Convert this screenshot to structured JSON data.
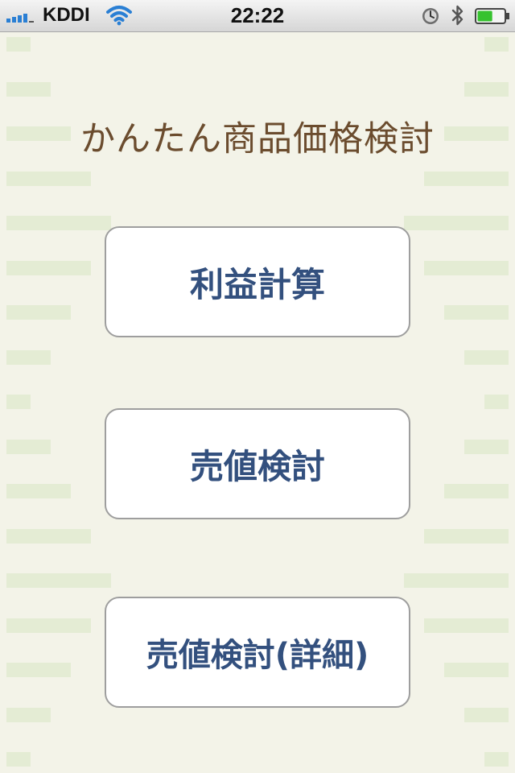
{
  "status_bar": {
    "carrier": "KDDI",
    "time": "22:22",
    "battery_level": 0.55,
    "battery_color": "#36c22f",
    "signal_color": "#2a7fd4",
    "wifi_color": "#2a7fd4",
    "icons": [
      "signal-bars-icon",
      "wifi-icon",
      "alarm-clock-icon",
      "bluetooth-icon",
      "battery-icon"
    ]
  },
  "app": {
    "title": "かんたん商品価格検討",
    "title_color": "#6b4c2e"
  },
  "menu": {
    "label_color": "#33507e",
    "buttons": [
      {
        "label": "利益計算"
      },
      {
        "label": "売値検討"
      },
      {
        "label": "売値検討(詳細)"
      }
    ]
  }
}
